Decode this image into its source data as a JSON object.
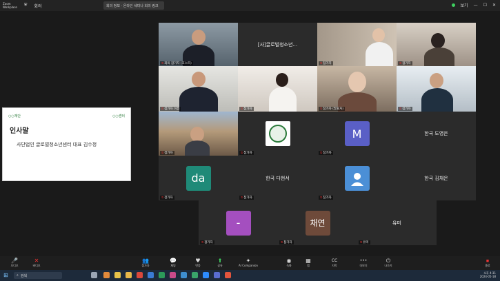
{
  "topbar": {
    "app_name": "Zoom\nWorkplace",
    "tab_label": "회의",
    "window_title": "회의 정보 · 온라인 세미나 회의 링크",
    "view_label": "보기"
  },
  "slide": {
    "logo_left": "○○재단",
    "logo_right": "○○센터",
    "title": "인사말",
    "subtitle": "사단법인 글로벌청소년센터 대표 김수정"
  },
  "tiles": [
    {
      "id": "t1",
      "label": "회의 참가자 (호스트)"
    },
    {
      "id": "t2",
      "center_text": "[사]글로벌청소년...",
      "label": ""
    },
    {
      "id": "t3",
      "label": "참가자"
    },
    {
      "id": "t4",
      "label": "참가자"
    },
    {
      "id": "t5",
      "label": "참가자 이름"
    },
    {
      "id": "t6",
      "label": "참가자"
    },
    {
      "id": "t7",
      "label": "참가자 (발표자)"
    },
    {
      "id": "t8",
      "label": "참가자"
    },
    {
      "id": "t9",
      "label": "참가자"
    },
    {
      "id": "t10",
      "label": "참가자"
    },
    {
      "id": "t11",
      "avatar": "M",
      "label": "참가자"
    },
    {
      "id": "t12",
      "center_text": "한국 도영은",
      "label": ""
    },
    {
      "id": "t13",
      "avatar": "da",
      "label": "참가자"
    },
    {
      "id": "t14",
      "center_text": "한국 다현서",
      "label": "참가자"
    },
    {
      "id": "t15",
      "label": "참가자"
    },
    {
      "id": "t16",
      "center_text": "한국 김채은",
      "label": ""
    },
    {
      "id": "t17",
      "avatar": "-",
      "label": "참가자"
    },
    {
      "id": "t18",
      "avatar": "채연",
      "label": "참가자"
    },
    {
      "id": "t19",
      "center_text": "유미",
      "label": "유미"
    }
  ],
  "toolbar": {
    "items": [
      {
        "icon": "mic-icon",
        "glyph": "🎤",
        "label": "오디오"
      },
      {
        "icon": "video-off-icon",
        "glyph": "✕",
        "label": "비디오"
      },
      {
        "icon": "participants-icon",
        "glyph": "👥",
        "label": "참가자"
      },
      {
        "icon": "chat-icon",
        "glyph": "💬",
        "label": "채팅"
      },
      {
        "icon": "react-icon",
        "glyph": "♥",
        "label": "반응"
      },
      {
        "icon": "share-icon",
        "glyph": "⬆",
        "label": "공유"
      },
      {
        "icon": "ai-icon",
        "glyph": "✦",
        "label": "AI Companion"
      },
      {
        "icon": "record-icon",
        "glyph": "◉",
        "label": "녹화"
      },
      {
        "icon": "apps-icon",
        "glyph": "▦",
        "label": "앱"
      },
      {
        "icon": "caption-icon",
        "glyph": "CC",
        "label": "자막"
      },
      {
        "icon": "more-icon",
        "glyph": "•••",
        "label": "더보기"
      },
      {
        "icon": "leave-icon",
        "glyph": "⏻",
        "label": "나가기"
      }
    ],
    "end_label": "종료"
  },
  "taskbar": {
    "search_placeholder": "검색",
    "time": "오후 4:31",
    "date": "2024-05-18"
  },
  "colors": {
    "active_speaker": "#3ecf5f",
    "avatar_m": "#5a5fc6",
    "avatar_da": "#1f8a78",
    "avatar_dash": "#a44fbf",
    "avatar_chaeyeon": "#6e4a3a",
    "avatar_user": "#4b8fd6"
  }
}
